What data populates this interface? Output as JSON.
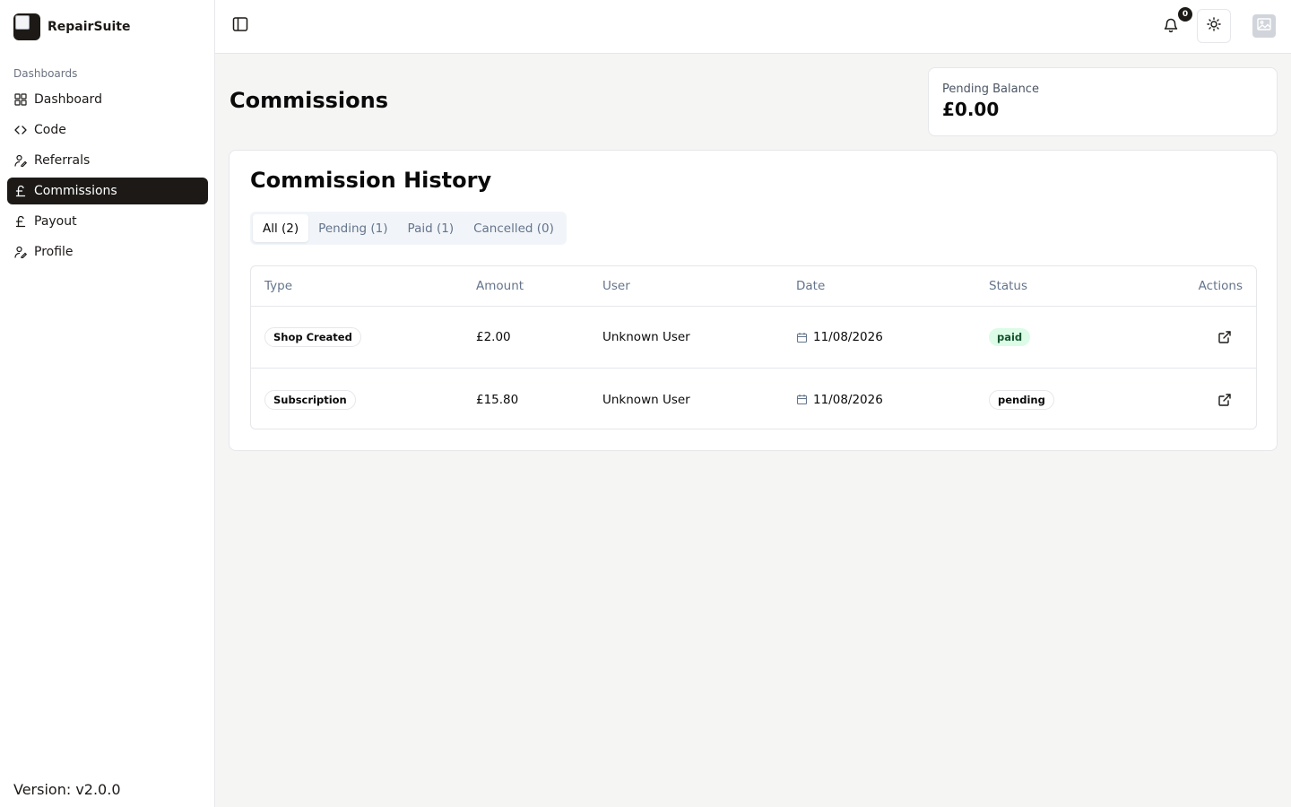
{
  "brand": {
    "name": "RepairSuite"
  },
  "sidebar": {
    "group_label": "Dashboards",
    "items": [
      {
        "label": "Dashboard",
        "icon": "grid-icon",
        "active": false
      },
      {
        "label": "Code",
        "icon": "code-icon",
        "active": false
      },
      {
        "label": "Referrals",
        "icon": "user-pen-icon",
        "active": false
      },
      {
        "label": "Commissions",
        "icon": "pound-icon",
        "active": true
      },
      {
        "label": "Payout",
        "icon": "pound-icon",
        "active": false
      },
      {
        "label": "Profile",
        "icon": "user-pen-icon",
        "active": false
      }
    ],
    "version": "Version: v2.0.0"
  },
  "header": {
    "notification_count": "0"
  },
  "main": {
    "title": "Commissions",
    "balance": {
      "label": "Pending Balance",
      "value": "£0.00"
    },
    "history": {
      "title": "Commission History",
      "tabs": [
        {
          "label": "All (2)",
          "active": true
        },
        {
          "label": "Pending (1)",
          "active": false
        },
        {
          "label": "Paid (1)",
          "active": false
        },
        {
          "label": "Cancelled (0)",
          "active": false
        }
      ],
      "columns": {
        "type": "Type",
        "amount": "Amount",
        "user": "User",
        "date": "Date",
        "status": "Status",
        "actions": "Actions"
      },
      "rows": [
        {
          "type": "Shop Created",
          "amount": "£2.00",
          "user": "Unknown User",
          "date": "11/08/2026",
          "status": "paid"
        },
        {
          "type": "Subscription",
          "amount": "£15.80",
          "user": "Unknown User",
          "date": "11/08/2026",
          "status": "pending"
        }
      ]
    }
  },
  "colors": {
    "accent": "#1c1917",
    "paid_bg": "#dcfce7",
    "background": "#f5f5f4"
  }
}
